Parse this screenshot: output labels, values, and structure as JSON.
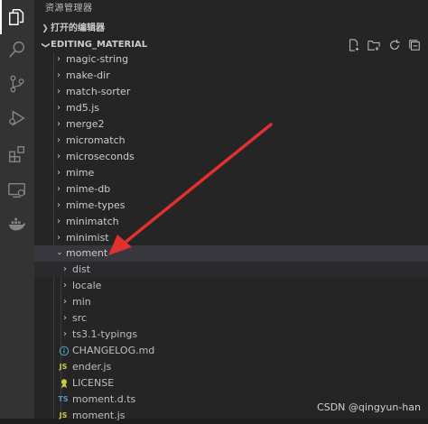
{
  "sidebar": {
    "title": "资源管理器",
    "open_editors": "打开的编辑器",
    "project": "EDITING_MATERIAL"
  },
  "tree": {
    "folders_top": [
      {
        "label": "magic-string"
      },
      {
        "label": "make-dir"
      },
      {
        "label": "match-sorter"
      },
      {
        "label": "md5.js"
      },
      {
        "label": "merge2"
      },
      {
        "label": "micromatch"
      },
      {
        "label": "microseconds"
      },
      {
        "label": "mime"
      },
      {
        "label": "mime-db"
      },
      {
        "label": "mime-types"
      },
      {
        "label": "minimatch"
      },
      {
        "label": "minimist"
      }
    ],
    "expanded": {
      "label": "moment"
    },
    "children_folders": [
      {
        "label": "dist"
      },
      {
        "label": "locale"
      },
      {
        "label": "min"
      },
      {
        "label": "src"
      },
      {
        "label": "ts3.1-typings"
      }
    ],
    "children_files": [
      {
        "label": "CHANGELOG.md",
        "icon": "info-icon",
        "color": "#519aba"
      },
      {
        "label": "ender.js",
        "icon": "js-icon",
        "color": "#cbcb41"
      },
      {
        "label": "LICENSE",
        "icon": "license-icon",
        "color": "#cbcb41"
      },
      {
        "label": "moment.d.ts",
        "icon": "ts-icon",
        "color": "#519aba"
      },
      {
        "label": "moment.js",
        "icon": "js-icon",
        "color": "#cbcb41"
      }
    ]
  },
  "watermark": "CSDN @qingyun-han",
  "colors": {
    "arrow": "#e03030",
    "selected_row": "#37373d"
  }
}
